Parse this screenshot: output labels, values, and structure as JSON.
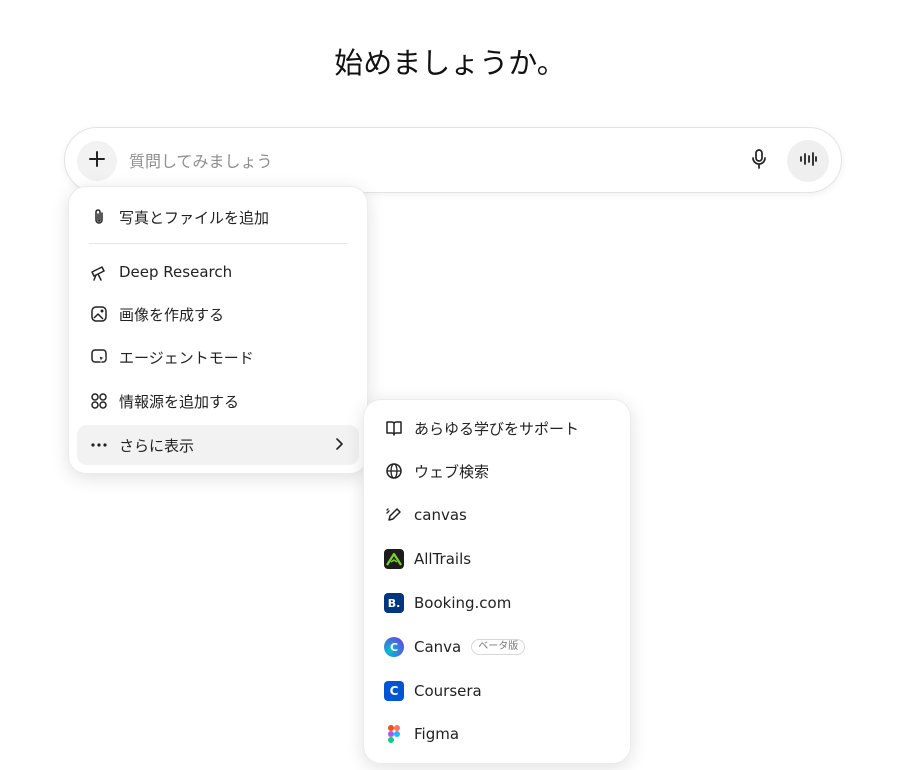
{
  "heading": "始めましょうか。",
  "composer": {
    "placeholder": "質問してみましょう",
    "plus_icon": "plus-icon",
    "mic_icon": "microphone-icon",
    "voice_icon": "voice-waveform-icon"
  },
  "menu": {
    "items": [
      {
        "label": "写真とファイルを追加",
        "icon": "paperclip-icon"
      },
      {
        "label": "Deep Research",
        "icon": "telescope-icon"
      },
      {
        "label": "画像を作成する",
        "icon": "image-create-icon"
      },
      {
        "label": "エージェントモード",
        "icon": "agent-cursor-icon"
      },
      {
        "label": "情報源を追加する",
        "icon": "apps-grid-icon"
      },
      {
        "label": "さらに表示",
        "icon": "more-dots-icon"
      }
    ]
  },
  "submenu": {
    "items": [
      {
        "label": "あらゆる学びをサポート",
        "icon": "book-icon"
      },
      {
        "label": "ウェブ検索",
        "icon": "globe-icon"
      },
      {
        "label": "canvas",
        "icon": "pen-icon"
      },
      {
        "label": "AllTrails",
        "icon": "alltrails-logo",
        "color": "#1c1c1c",
        "accent": "#7ed321"
      },
      {
        "label": "Booking.com",
        "icon": "booking-logo",
        "color": "#003580"
      },
      {
        "label": "Canva",
        "icon": "canva-logo",
        "color": "#00c4cc",
        "badge": "ベータ版"
      },
      {
        "label": "Coursera",
        "icon": "coursera-logo",
        "color": "#0056d2"
      },
      {
        "label": "Figma",
        "icon": "figma-logo"
      }
    ]
  }
}
